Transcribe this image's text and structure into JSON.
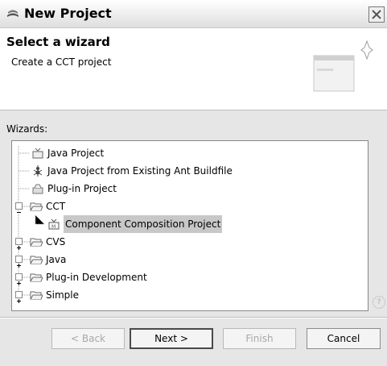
{
  "window": {
    "title": "New Project"
  },
  "header": {
    "title": "Select a wizard",
    "description": "Create a CCT project"
  },
  "wizards_label": "Wizards:",
  "tree": [
    {
      "label": "Java Project",
      "icon": "java-project-icon",
      "level": 1,
      "expander": null
    },
    {
      "label": "Java Project from Existing Ant Buildfile",
      "icon": "ant-icon",
      "level": 1,
      "expander": null
    },
    {
      "label": "Plug-in Project",
      "icon": "plugin-project-icon",
      "level": 1,
      "expander": null
    },
    {
      "label": "CCT",
      "icon": "folder-open-icon",
      "level": 0,
      "expander": "-"
    },
    {
      "label": "Component Composition Project",
      "icon": "cct-project-icon",
      "level": 2,
      "expander": null,
      "selected": true
    },
    {
      "label": "CVS",
      "icon": "folder-icon",
      "level": 0,
      "expander": "+"
    },
    {
      "label": "Java",
      "icon": "folder-icon",
      "level": 0,
      "expander": "+"
    },
    {
      "label": "Plug-in Development",
      "icon": "folder-icon",
      "level": 0,
      "expander": "+"
    },
    {
      "label": "Simple",
      "icon": "folder-icon",
      "level": 0,
      "expander": "+"
    }
  ],
  "buttons": {
    "back": "< Back",
    "next": "Next >",
    "finish": "Finish",
    "cancel": "Cancel"
  },
  "colors": {
    "selection": "#c8c8c8",
    "disabled_text": "#a8a8a8"
  }
}
